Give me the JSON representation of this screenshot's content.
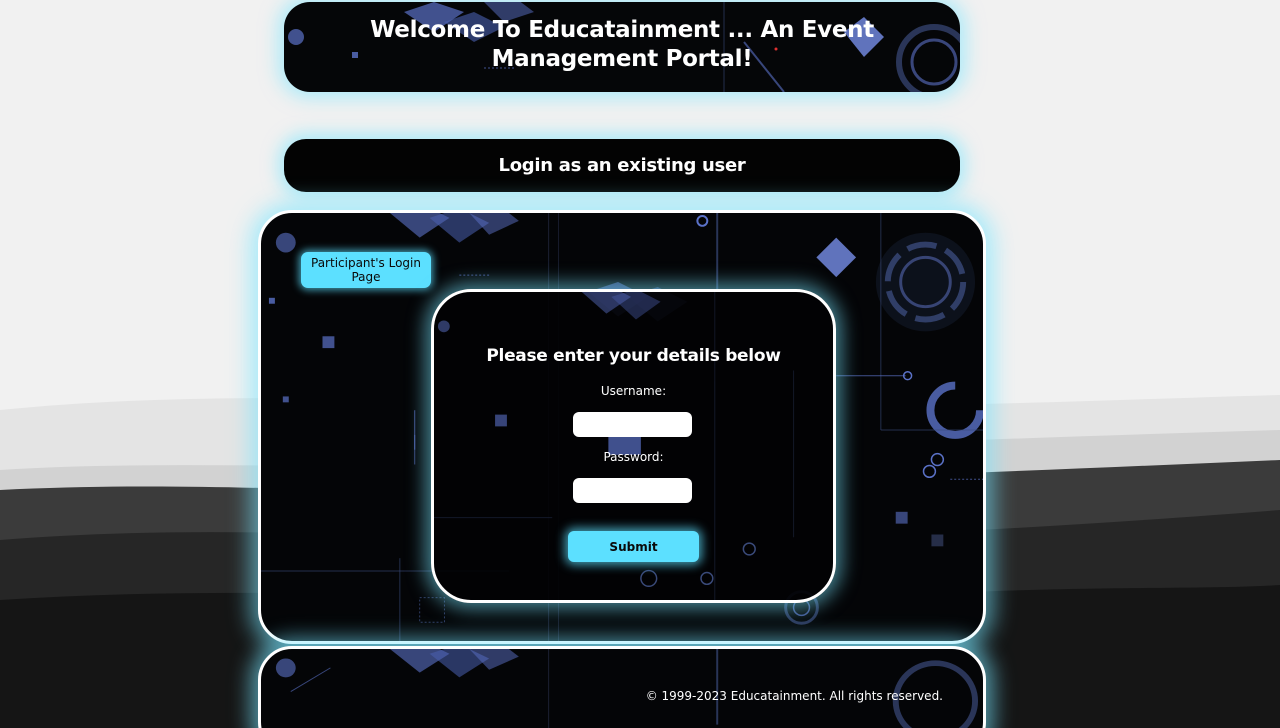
{
  "header": {
    "title": "Welcome To Educatainment ... An Event Management Portal!"
  },
  "login_bar": {
    "label": "Login as an existing user"
  },
  "main": {
    "participant_login_label": "Participant's Login Page",
    "form": {
      "heading": "Please enter your details below",
      "username_label": "Username:",
      "username_value": "",
      "password_label": "Password:",
      "password_value": "",
      "submit_label": "Submit"
    }
  },
  "footer": {
    "copyright": "© 1999-2023 Educatainment. All rights reserved."
  },
  "colors": {
    "accent": "#5ce0ff",
    "glow": "#78e6ff",
    "panel_bg": "#040507",
    "page_bg": "#f0f0f0",
    "tech_blue": "#5b72c8"
  }
}
